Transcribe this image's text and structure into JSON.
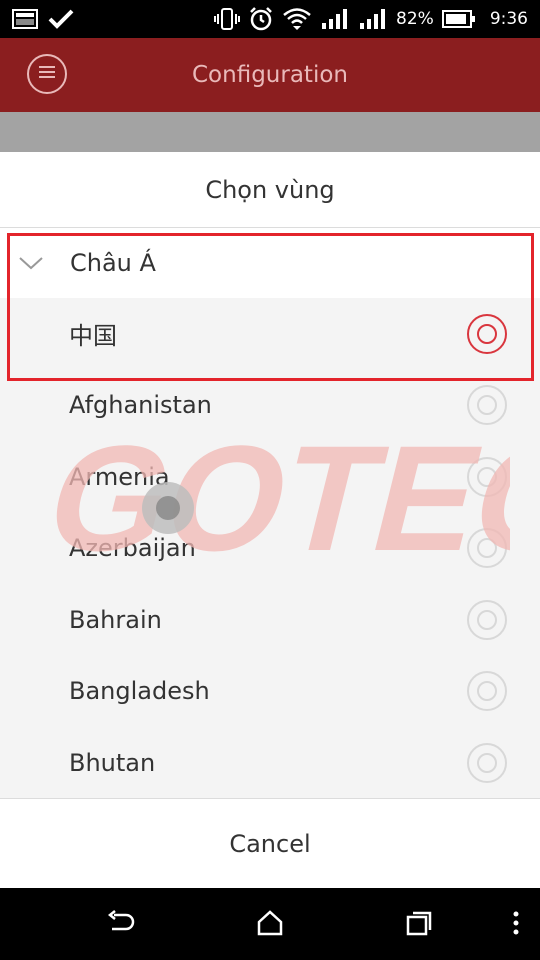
{
  "status_bar": {
    "battery_percent": "82%",
    "time": "9:36",
    "icons": [
      "screenshot-icon",
      "check-icon",
      "vibrate-icon",
      "alarm-icon",
      "wifi-icon",
      "signal-icon",
      "signal-icon-2",
      "battery-icon"
    ]
  },
  "app_bar": {
    "title": "Configuration",
    "menu_icon": "menu-icon"
  },
  "dialog": {
    "title": "Chọn vùng",
    "group": {
      "label": "Châu Á",
      "expanded": true
    },
    "countries": [
      {
        "label": "中国",
        "selected": true
      },
      {
        "label": "Afghanistan",
        "selected": false
      },
      {
        "label": "Armenia",
        "selected": false
      },
      {
        "label": "Azerbaijan",
        "selected": false
      },
      {
        "label": "Bahrain",
        "selected": false
      },
      {
        "label": "Bangladesh",
        "selected": false
      },
      {
        "label": "Bhutan",
        "selected": false
      }
    ],
    "cancel_label": "Cancel"
  },
  "watermark": {
    "text": "GOTECH"
  },
  "colors": {
    "app_bar": "#8b1e1f",
    "accent": "#d9363e",
    "highlight": "#e3242b"
  },
  "nav_bar": {
    "icons": [
      "back-icon",
      "home-icon",
      "recents-icon",
      "overflow-icon"
    ]
  }
}
